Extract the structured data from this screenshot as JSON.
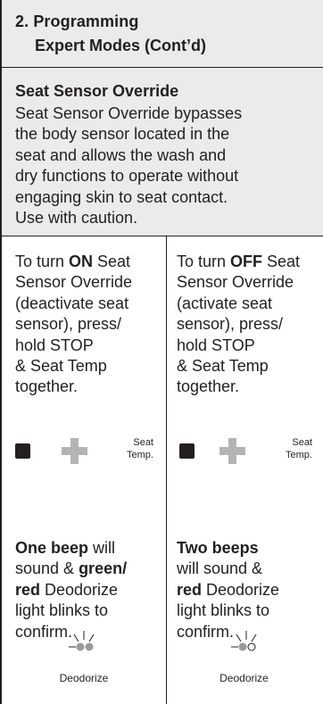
{
  "header": {
    "line1": "2. Programming",
    "line2": "Expert Modes (Cont’d)"
  },
  "intro": {
    "title": "Seat Sensor Override",
    "lines": [
      "Seat Sensor Override bypasses",
      "the body sensor located in the",
      "seat and allows the wash and",
      "dry functions to operate without",
      "engaging skin to seat contact.",
      "Use with caution."
    ]
  },
  "left": {
    "steps": [
      [
        {
          "t": "To turn "
        },
        {
          "t": "ON",
          "b": true
        },
        {
          "t": " Seat"
        }
      ],
      [
        {
          "t": "Sensor Override"
        }
      ],
      [
        {
          "t": "(deactivate seat"
        }
      ],
      [
        {
          "t": "sensor), press/"
        }
      ],
      [
        {
          "t": "hold STOP"
        }
      ],
      [
        {
          "t": "& Seat Temp"
        }
      ],
      [
        {
          "t": "together."
        }
      ]
    ],
    "seat_label": [
      "Seat",
      "Temp."
    ],
    "result": [
      [
        {
          "t": "One beep",
          "b": true
        },
        {
          "t": " will"
        }
      ],
      [
        {
          "t": "sound & "
        },
        {
          "t": "green/",
          "b": true
        }
      ],
      [
        {
          "t": "red",
          "b": true
        },
        {
          "t": " Deodorize"
        }
      ],
      [
        {
          "t": "light blinks to"
        }
      ],
      [
        {
          "t": "confirm."
        }
      ]
    ],
    "indicator_label": "Deodorize",
    "indicator_state": "both-lit"
  },
  "right": {
    "steps": [
      [
        {
          "t": "To turn "
        },
        {
          "t": "OFF",
          "b": true
        },
        {
          "t": " Seat"
        }
      ],
      [
        {
          "t": "Sensor Override"
        }
      ],
      [
        {
          "t": "(activate seat"
        }
      ],
      [
        {
          "t": "sensor), press/"
        }
      ],
      [
        {
          "t": "hold STOP"
        }
      ],
      [
        {
          "t": "& Seat Temp"
        }
      ],
      [
        {
          "t": "together."
        }
      ]
    ],
    "seat_label": [
      "Seat",
      "Temp."
    ],
    "result": [
      [
        {
          "t": "Two beeps",
          "b": true
        }
      ],
      [
        {
          "t": "will sound &"
        }
      ],
      [
        {
          "t": "red",
          "b": true
        },
        {
          "t": " Deodorize"
        }
      ],
      [
        {
          "t": "light blinks to"
        }
      ],
      [
        {
          "t": "confirm."
        }
      ]
    ],
    "indicator_label": "Deodorize",
    "indicator_state": "one-lit"
  },
  "colors": {
    "text": "#231f20",
    "panel": "#ebebeb",
    "plus": "#b4b4b4",
    "led": "#9a9a9a"
  },
  "icons": {
    "stop": "stop-square-icon",
    "seat_temp": "plus-icon",
    "deodorize": "blinking-led-icon"
  }
}
